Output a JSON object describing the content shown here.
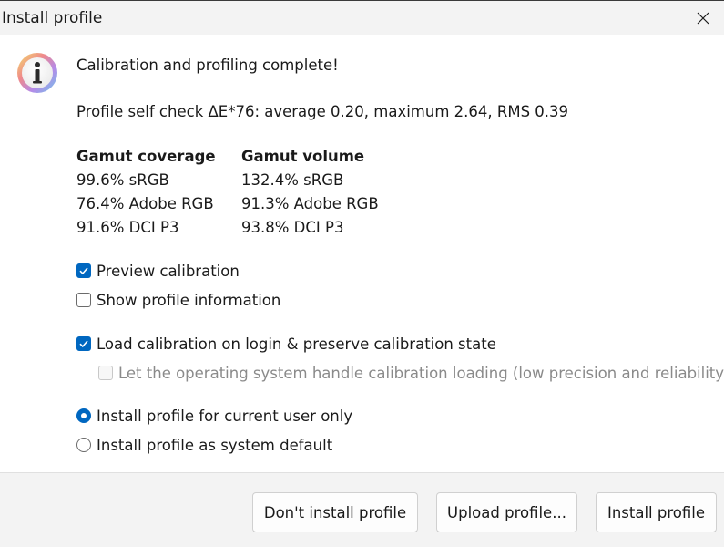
{
  "window": {
    "title": "Install profile"
  },
  "main": {
    "heading": "Calibration and profiling complete!",
    "self_check": "Profile self check ΔE*76: average 0.20, maximum 2.64, RMS 0.39",
    "gamut_coverage": {
      "header": "Gamut coverage",
      "rows": [
        "99.6% sRGB",
        "76.4% Adobe RGB",
        "91.6% DCI P3"
      ]
    },
    "gamut_volume": {
      "header": "Gamut volume",
      "rows": [
        "132.4% sRGB",
        "91.3% Adobe RGB",
        "93.8% DCI P3"
      ]
    },
    "options": {
      "preview_calibration": {
        "label": "Preview calibration",
        "checked": true
      },
      "show_profile_information": {
        "label": "Show profile information",
        "checked": false
      },
      "load_calibration": {
        "label": "Load calibration on login & preserve calibration state",
        "checked": true
      },
      "os_handle_loading": {
        "label": "Let the operating system handle calibration loading (low precision and reliability)",
        "checked": false,
        "disabled": true
      }
    },
    "install_scope": {
      "current_user": {
        "label": "Install profile for current user only",
        "selected": true
      },
      "system_default": {
        "label": "Install profile as system default",
        "selected": false
      }
    }
  },
  "footer": {
    "dont_install_label": "Don't install profile",
    "upload_label": "Upload profile...",
    "install_label": "Install profile"
  },
  "colors": {
    "accent": "#0067c0",
    "titlebar": "#f3f3f3",
    "footer": "#f3f3f3"
  },
  "icons": {
    "info": "info-icon",
    "close": "close-icon"
  }
}
